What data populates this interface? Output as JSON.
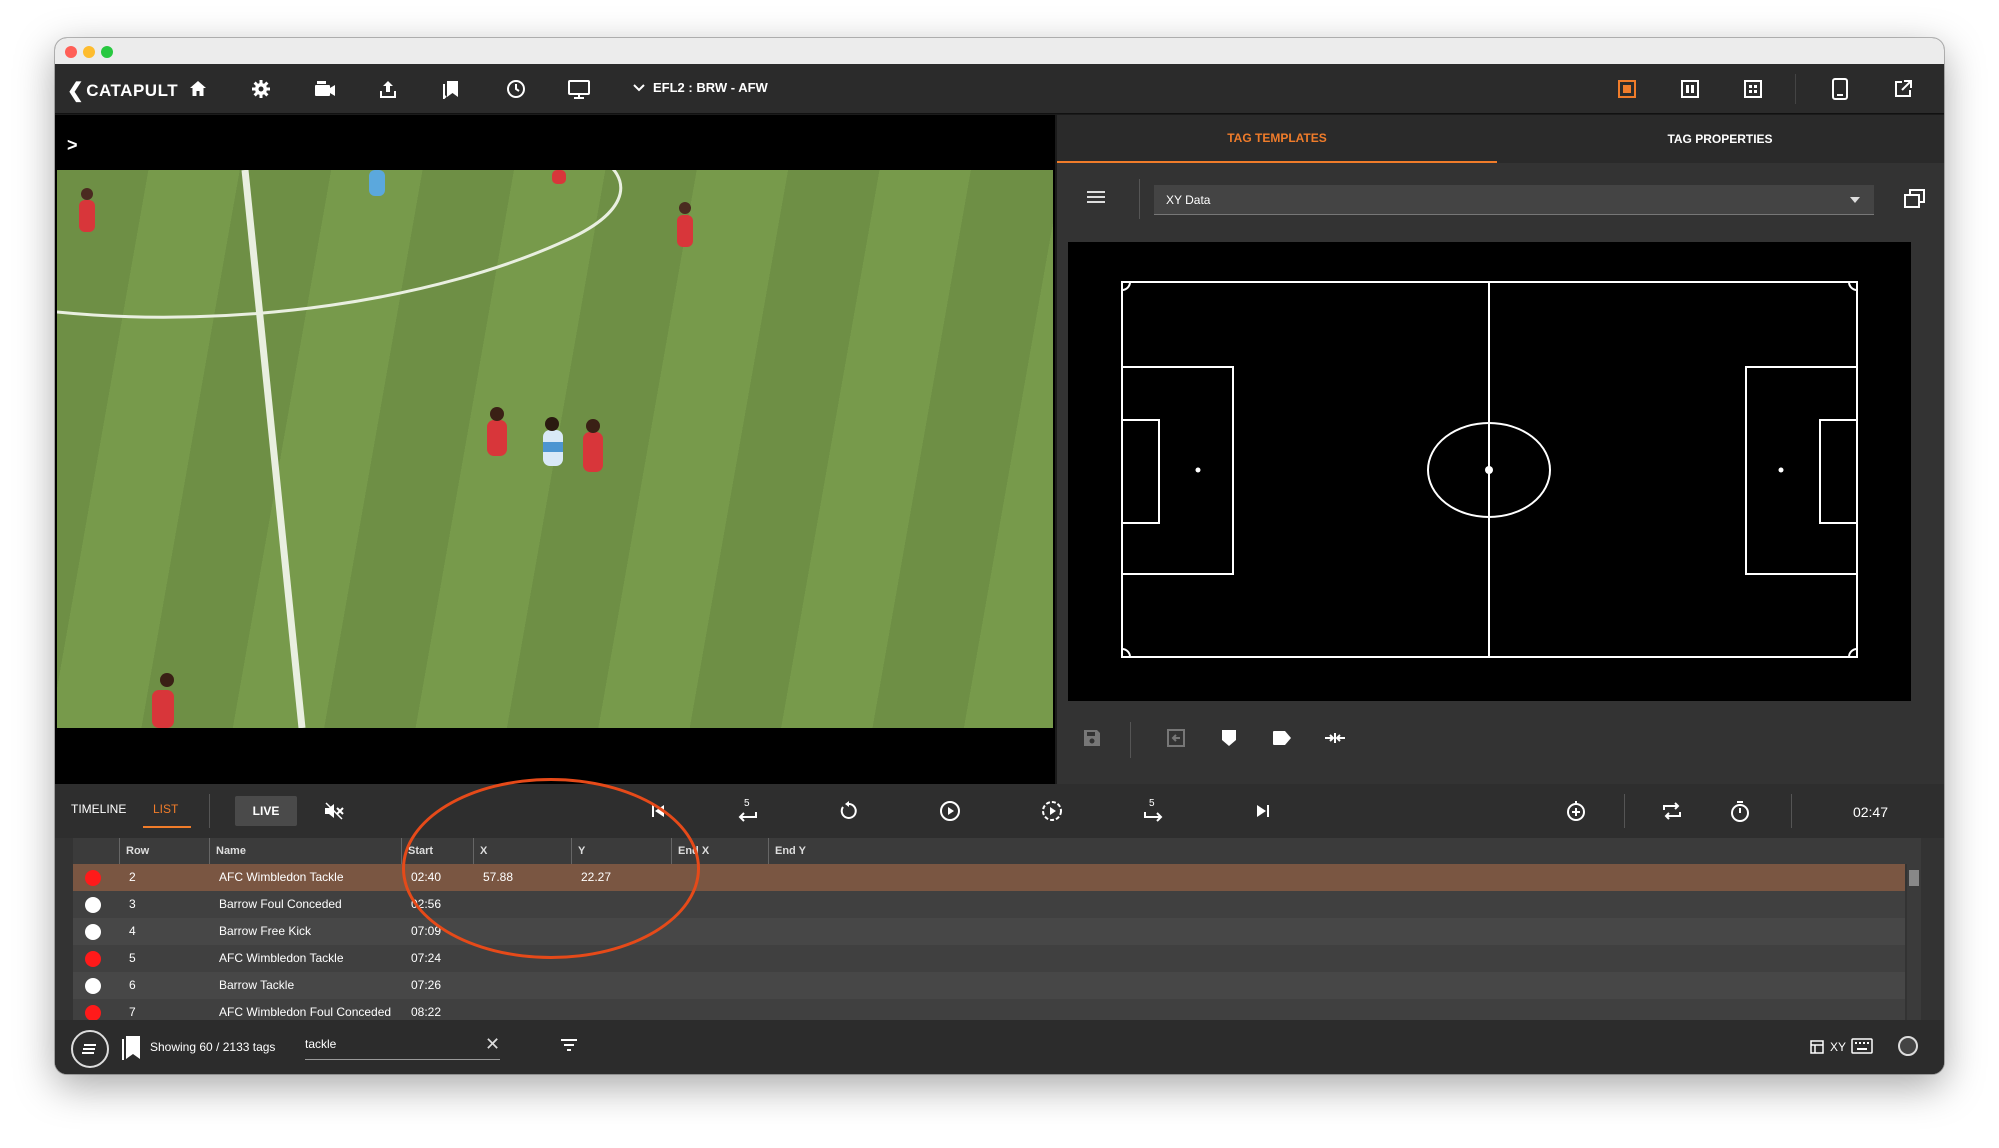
{
  "toolbar": {
    "logo": "CATAPULT",
    "match_label": "EFL2 : BRW - AFW",
    "icons": [
      "home-icon",
      "gear-icon",
      "camera-icon",
      "upload-icon",
      "bookmarks-icon",
      "clock-icon",
      "monitor-icon",
      "chevron-down-icon",
      "single-view-icon",
      "split-view-icon",
      "grid-view-icon",
      "tablet-icon",
      "external-link-icon"
    ]
  },
  "tag_panel": {
    "tabs": [
      "TAG TEMPLATES",
      "TAG PROPERTIES"
    ],
    "active_tab": "TAG TEMPLATES",
    "template_select": "XY Data"
  },
  "controls": {
    "timeline_label": "TIMELINE",
    "list_label": "LIST",
    "live_label": "LIVE",
    "skip_back_label": "5",
    "skip_forward_label": "5",
    "current_time": "02:47"
  },
  "table": {
    "columns": [
      "Row",
      "Name",
      "Start",
      "X",
      "Y",
      "End X",
      "End Y"
    ],
    "rows": [
      {
        "dot": "#ff1a1a",
        "row": "2",
        "name": "AFC Wimbledon Tackle",
        "start": "02:40",
        "x": "57.88",
        "y": "22.27",
        "highlight": true
      },
      {
        "dot": "#ffffff",
        "row": "3",
        "name": "Barrow Foul Conceded",
        "start": "02:56",
        "x": "",
        "y": ""
      },
      {
        "dot": "#ffffff",
        "row": "4",
        "name": "Barrow Free Kick",
        "start": "07:09",
        "x": "",
        "y": ""
      },
      {
        "dot": "#ff1a1a",
        "row": "5",
        "name": "AFC Wimbledon Tackle",
        "start": "07:24",
        "x": "",
        "y": ""
      },
      {
        "dot": "#ffffff",
        "row": "6",
        "name": "Barrow Tackle",
        "start": "07:26",
        "x": "",
        "y": ""
      },
      {
        "dot": "#ff1a1a",
        "row": "7",
        "name": "AFC Wimbledon Foul Conceded",
        "start": "08:22",
        "x": "",
        "y": ""
      }
    ]
  },
  "status": {
    "showing": "Showing 60 / 2133 tags",
    "search_value": "tackle",
    "xy_label": "XY"
  },
  "colors": {
    "accent": "#f07c2a",
    "highlight_row": "#7a5642",
    "annotation": "#e64a19"
  }
}
